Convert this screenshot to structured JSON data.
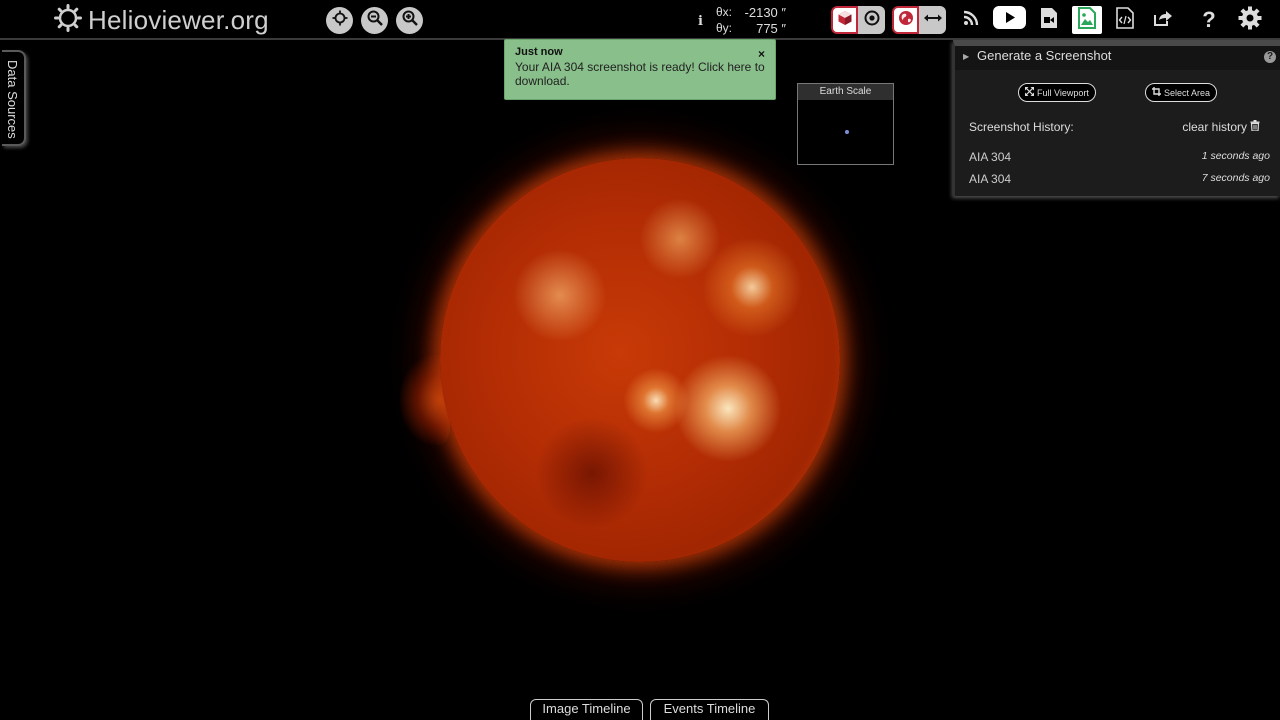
{
  "header": {
    "logo_text": "Helioviewer.org"
  },
  "coords": {
    "x_label": "θx:",
    "x_value": "-2130 ″",
    "y_label": "θy:",
    "y_value": "775 ″"
  },
  "toolbar_icons": [
    "center-icon",
    "zoom-out-icon",
    "zoom-in-icon",
    "cube-3d-icon",
    "target-icon",
    "globe-icon",
    "arrows-horizontal-icon",
    "rss-icon",
    "youtube-icon",
    "movie-icon",
    "screenshot-icon",
    "embed-icon",
    "share-icon",
    "help-icon",
    "settings-icon"
  ],
  "side_tab": {
    "label": "Data Sources"
  },
  "toast": {
    "title": "Just now",
    "message": "Your AIA 304 screenshot is ready! Click here to download.",
    "close": "×"
  },
  "earth_scale": {
    "title": "Earth Scale"
  },
  "panel": {
    "title": "Generate a Screenshot",
    "help": "?",
    "full_viewport": "Full Viewport",
    "select_area": "Select Area",
    "history_label": "Screenshot History:",
    "clear_history": "clear history",
    "history": [
      {
        "name": "AIA 304",
        "time": "1 seconds ago"
      },
      {
        "name": "AIA 304",
        "time": "7 seconds ago"
      }
    ]
  },
  "timelines": {
    "image": "Image Timeline",
    "events": "Events Timeline"
  },
  "colors": {
    "accent_red": "#c0283a",
    "toast_green": "#88bf8a",
    "screenshot_icon": "#2aa85a"
  }
}
